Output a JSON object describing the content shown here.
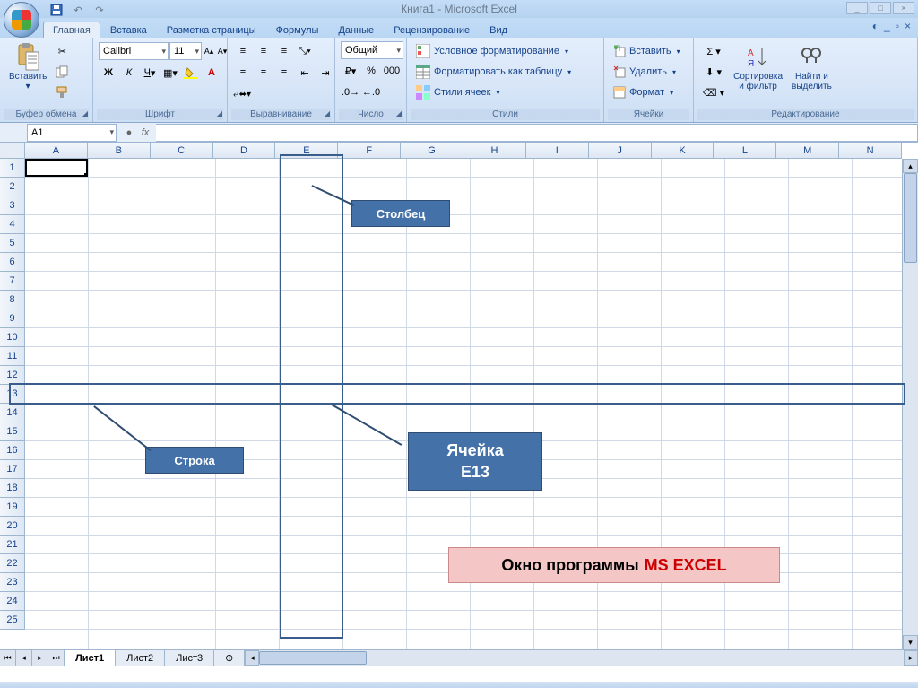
{
  "app_title": "Книга1 - Microsoft Excel",
  "tabs": [
    "Главная",
    "Вставка",
    "Разметка страницы",
    "Формулы",
    "Данные",
    "Рецензирование",
    "Вид"
  ],
  "active_tab": 0,
  "groups": {
    "clipboard": {
      "title": "Буфер обмена",
      "paste": "Вставить"
    },
    "font": {
      "title": "Шрифт",
      "name": "Calibri",
      "size": "11"
    },
    "alignment": {
      "title": "Выравнивание"
    },
    "number": {
      "title": "Число",
      "format": "Общий"
    },
    "styles": {
      "title": "Стили",
      "cond": "Условное форматирование",
      "table": "Форматировать как таблицу",
      "cell": "Стили ячеек"
    },
    "cells": {
      "title": "Ячейки",
      "insert": "Вставить",
      "delete": "Удалить",
      "format": "Формат"
    },
    "editing": {
      "title": "Редактирование",
      "sort": "Сортировка\nи фильтр",
      "find": "Найти и\nвыделить"
    }
  },
  "name_box": "A1",
  "columns": [
    "A",
    "B",
    "C",
    "D",
    "E",
    "F",
    "G",
    "H",
    "I",
    "J",
    "K",
    "L",
    "M",
    "N"
  ],
  "rows": [
    "1",
    "2",
    "3",
    "4",
    "5",
    "6",
    "7",
    "8",
    "9",
    "10",
    "11",
    "12",
    "13",
    "14",
    "15",
    "16",
    "17",
    "18",
    "19",
    "20",
    "21",
    "22",
    "23",
    "24",
    "25"
  ],
  "sheets": [
    "Лист1",
    "Лист2",
    "Лист3"
  ],
  "active_sheet": 0,
  "annotations": {
    "column_label": "Столбец",
    "row_label": "Строка",
    "cell_label": "Ячейка\nЕ13",
    "title_text_black": "Окно программы",
    "title_text_red": "MS EXCEL"
  }
}
